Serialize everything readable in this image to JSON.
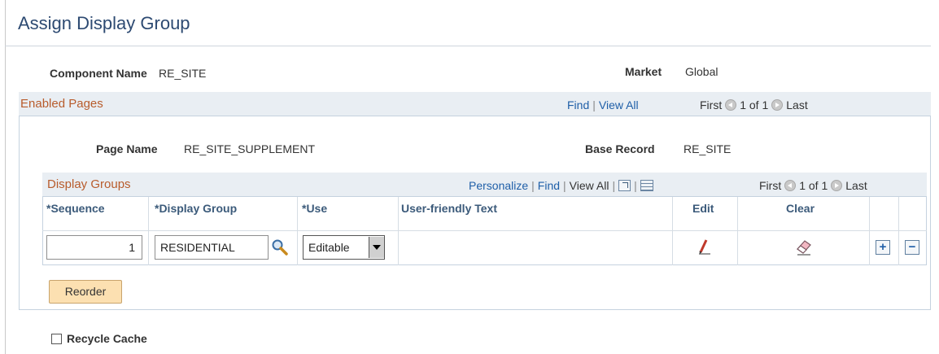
{
  "page": {
    "title": "Assign Display Group"
  },
  "component": {
    "name_label": "Component Name",
    "name_value": "RE_SITE",
    "market_label": "Market",
    "market_value": "Global"
  },
  "enabled_pages": {
    "title": "Enabled Pages",
    "find": "Find",
    "view_all": "View All",
    "first": "First",
    "range": "1 of 1",
    "last": "Last",
    "page_name_label": "Page Name",
    "page_name_value": "RE_SITE_SUPPLEMENT",
    "base_record_label": "Base Record",
    "base_record_value": "RE_SITE"
  },
  "display_groups": {
    "title": "Display Groups",
    "personalize": "Personalize",
    "find": "Find",
    "view_all": "View All",
    "first": "First",
    "range": "1 of 1",
    "last": "Last",
    "columns": {
      "sequence": "*Sequence",
      "display_group": "*Display Group",
      "use": "*Use",
      "user_friendly": "User-friendly Text",
      "edit": "Edit",
      "clear": "Clear"
    },
    "row": {
      "sequence": "1",
      "display_group": "RESIDENTIAL",
      "use": "Editable",
      "user_friendly": ""
    }
  },
  "buttons": {
    "reorder": "Reorder"
  },
  "recycle_cache": {
    "label": "Recycle Cache",
    "checked": false
  },
  "icons": [
    "search-icon",
    "edit-pencil-icon",
    "eraser-icon",
    "add-row-icon",
    "delete-row-icon",
    "prev-icon",
    "next-icon",
    "zoom-icon",
    "grid-icon",
    "checkbox-icon"
  ]
}
